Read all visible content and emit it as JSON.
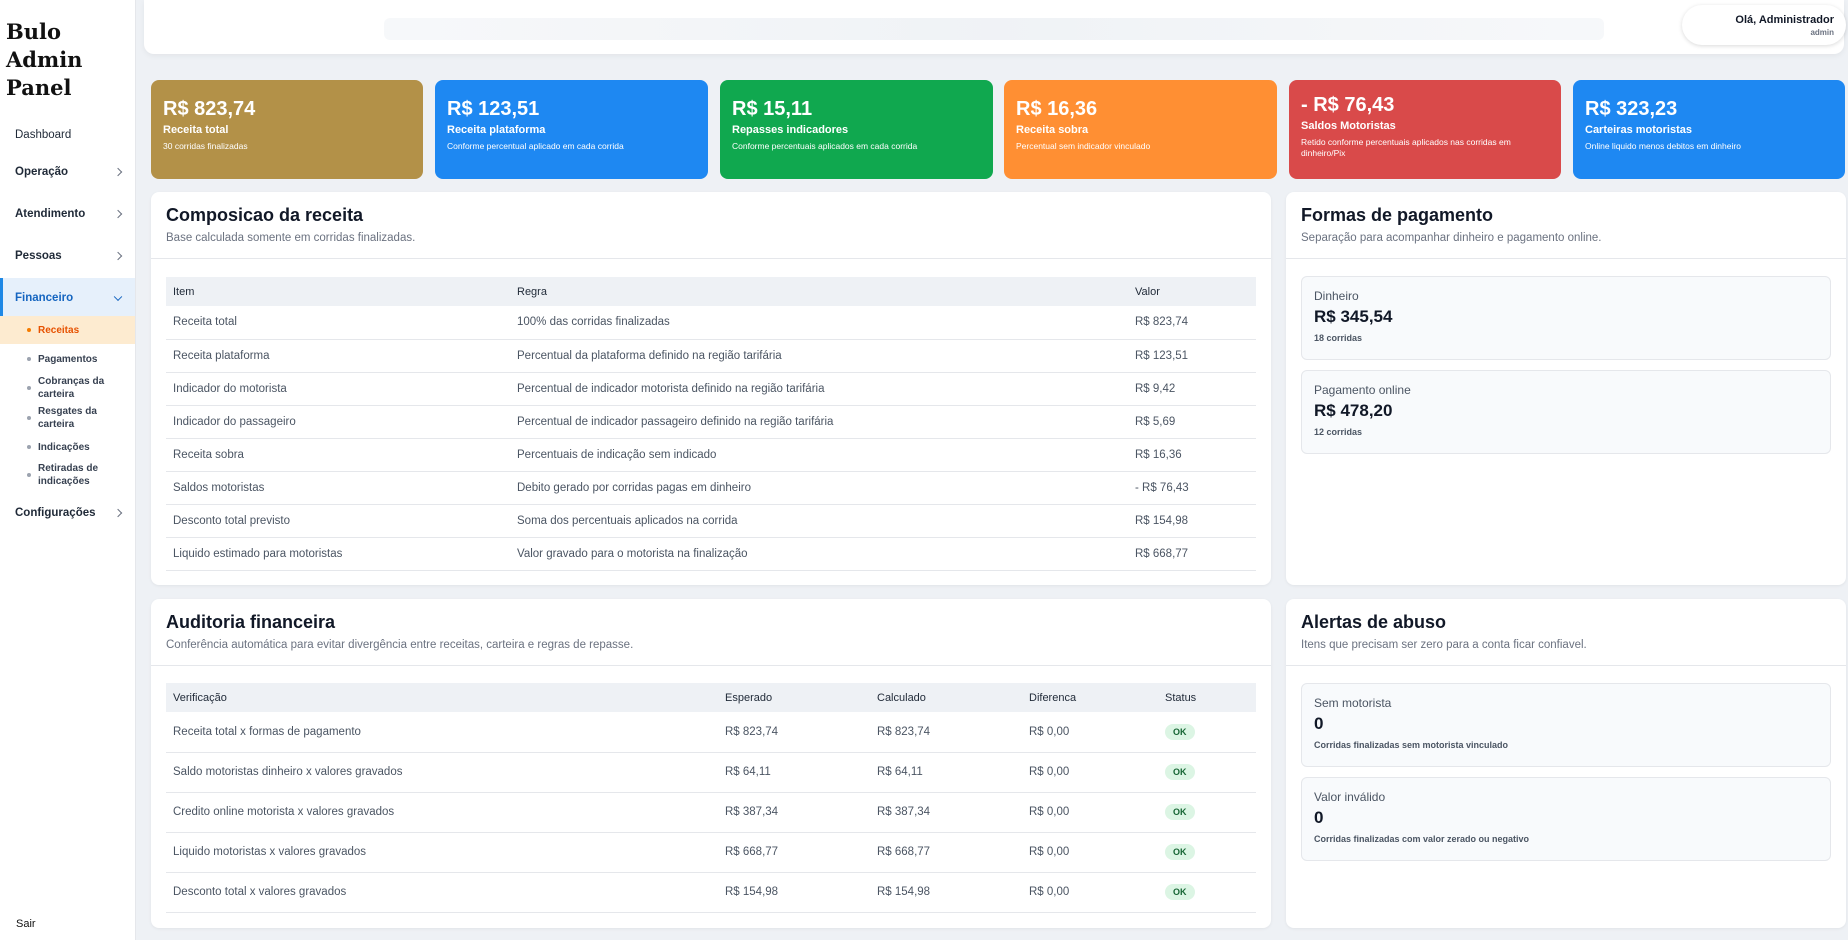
{
  "brand": {
    "line1": "Bulo",
    "line2": "Admin",
    "line3": "Panel"
  },
  "nav": {
    "dashboard": "Dashboard",
    "operacao": "Operação",
    "atendimento": "Atendimento",
    "pessoas": "Pessoas",
    "financeiro": "Financeiro",
    "configuracoes": "Configurações",
    "sair": "Sair",
    "financeiro_sub": [
      {
        "label": "Receitas"
      },
      {
        "label": "Pagamentos"
      },
      {
        "label": "Cobranças da carteira"
      },
      {
        "label": "Resgates da carteira"
      },
      {
        "label": "Indicações"
      },
      {
        "label": "Retiradas de indicações"
      }
    ]
  },
  "user": {
    "greeting": "Olá, Administrador",
    "role": "admin"
  },
  "kpis": [
    {
      "value": "R$ 823,74",
      "label": "Receita total",
      "desc": "30 corridas finalizadas",
      "color": "#b39148"
    },
    {
      "value": "R$ 123,51",
      "label": "Receita plataforma",
      "desc": "Conforme percentual aplicado em cada corrida",
      "color": "#1e88f2"
    },
    {
      "value": "R$ 15,11",
      "label": "Repasses indicadores",
      "desc": "Conforme percentuais aplicados em cada corrida",
      "color": "#10a84f"
    },
    {
      "value": "R$ 16,36",
      "label": "Receita sobra",
      "desc": "Percentual sem indicador vinculado",
      "color": "#ff8f33"
    },
    {
      "value": "- R$ 76,43",
      "label": "Saldos Motoristas",
      "desc": "Retido conforme percentuais aplicados nas corridas em dinheiro/Pix",
      "color": "#d94a4a"
    },
    {
      "value": "R$ 323,23",
      "label": "Carteiras motoristas",
      "desc": "Online liquido menos debitos em dinheiro",
      "color": "#1e88f2"
    }
  ],
  "composicao": {
    "title": "Composicao da receita",
    "subtitle": "Base calculada somente em corridas finalizadas.",
    "headers": [
      "Item",
      "Regra",
      "Valor"
    ],
    "rows": [
      [
        "Receita total",
        "100% das corridas finalizadas",
        "R$ 823,74"
      ],
      [
        "Receita plataforma",
        "Percentual da plataforma definido na região tarifária",
        "R$ 123,51"
      ],
      [
        "Indicador do motorista",
        "Percentual de indicador motorista definido na região tarifária",
        "R$ 9,42"
      ],
      [
        "Indicador do passageiro",
        "Percentual de indicador passageiro definido na região tarifária",
        "R$ 5,69"
      ],
      [
        "Receita sobra",
        "Percentuais de indicação sem indicado",
        "R$ 16,36"
      ],
      [
        "Saldos motoristas",
        "Debito gerado por corridas pagas em dinheiro",
        "- R$ 76,43"
      ],
      [
        "Desconto total previsto",
        "Soma dos percentuais aplicados na corrida",
        "R$ 154,98"
      ],
      [
        "Liquido estimado para motoristas",
        "Valor gravado para o motorista na finalização",
        "R$ 668,77"
      ]
    ]
  },
  "formas": {
    "title": "Formas de pagamento",
    "subtitle": "Separação para acompanhar dinheiro e pagamento online.",
    "cards": [
      {
        "label": "Dinheiro",
        "value": "R$ 345,54",
        "note": "18 corridas"
      },
      {
        "label": "Pagamento online",
        "value": "R$ 478,20",
        "note": "12 corridas"
      }
    ]
  },
  "auditoria": {
    "title": "Auditoria financeira",
    "subtitle": "Conferência automática para evitar divergência entre receitas, carteira e regras de repasse.",
    "headers": [
      "Verificação",
      "Esperado",
      "Calculado",
      "Diferenca",
      "Status"
    ],
    "rows": [
      [
        "Receita total x formas de pagamento",
        "R$ 823,74",
        "R$ 823,74",
        "R$ 0,00",
        "OK"
      ],
      [
        "Saldo motoristas dinheiro x valores gravados",
        "R$ 64,11",
        "R$ 64,11",
        "R$ 0,00",
        "OK"
      ],
      [
        "Credito online motorista x valores gravados",
        "R$ 387,34",
        "R$ 387,34",
        "R$ 0,00",
        "OK"
      ],
      [
        "Liquido motoristas x valores gravados",
        "R$ 668,77",
        "R$ 668,77",
        "R$ 0,00",
        "OK"
      ],
      [
        "Desconto total x valores gravados",
        "R$ 154,98",
        "R$ 154,98",
        "R$ 0,00",
        "OK"
      ]
    ]
  },
  "alertas": {
    "title": "Alertas de abuso",
    "subtitle": "Itens que precisam ser zero para a conta ficar confiavel.",
    "cards": [
      {
        "label": "Sem motorista",
        "value": "0",
        "note": "Corridas finalizadas sem motorista vinculado"
      },
      {
        "label": "Valor inválido",
        "value": "0",
        "note": "Corridas finalizadas com valor zerado ou negativo"
      }
    ]
  }
}
